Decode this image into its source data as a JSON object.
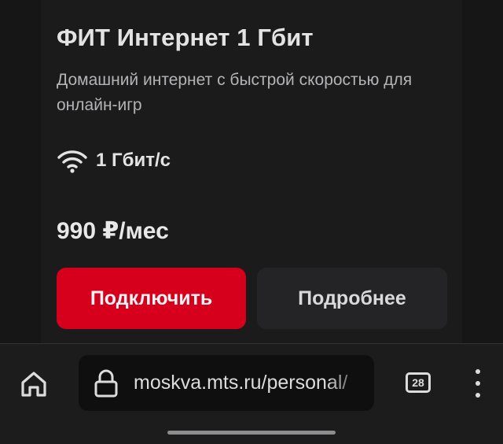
{
  "tariff": {
    "title": "ФИТ Интернет 1 Гбит",
    "description": "Домашний интернет с быстрой скоростью для онлайн-игр",
    "speed": "1 Гбит/с",
    "price": "990 ₽/мес",
    "speed_icon": "wifi-icon"
  },
  "actions": {
    "connect_label": "Подключить",
    "details_label": "Подробнее",
    "connect_color": "#d6001d"
  },
  "browser": {
    "url": "moskva.mts.ru/personal/",
    "tab_count": "28",
    "icons": [
      "home-icon",
      "lock-icon",
      "tabs-icon",
      "menu-icon"
    ]
  }
}
